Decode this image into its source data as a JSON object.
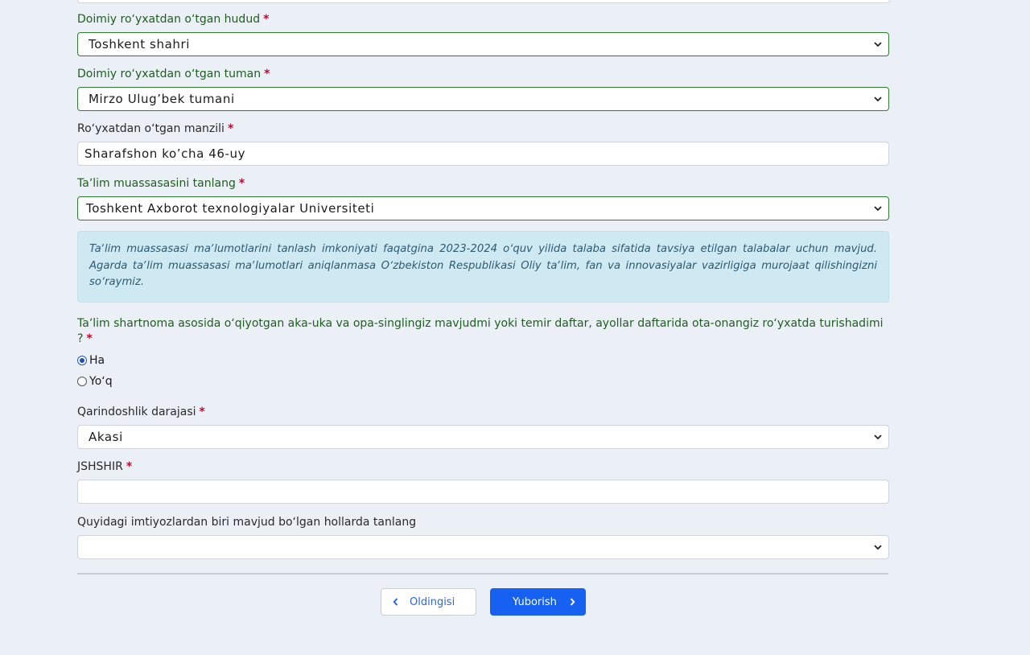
{
  "form": {
    "region": {
      "label": "Doimiy roʻyxatdan oʻtgan hudud",
      "required_mark": "*",
      "value": "Toshkent shahri"
    },
    "district": {
      "label": "Doimiy roʻyxatdan oʻtgan tuman",
      "required_mark": "*",
      "value": "Mirzo Ulug’bek tumani"
    },
    "address": {
      "label": "Roʻyxatdan oʻtgan manzili",
      "required_mark": "*",
      "value": "Sharafshon ko’cha 46-uy"
    },
    "institution": {
      "label": "Taʼlim muassasasini tanlang",
      "required_mark": "*",
      "value": "Toshkent Axborot texnologiyalar Universiteti"
    },
    "info_text": "Taʼlim muassasasi maʼlumotlarini tanlash imkoniyati faqatgina 2023-2024 oʻquv yilida talaba sifatida tavsiya etilgan talabalar uchun mavjud. Agarda taʼlim muassasasi maʼlumotlari aniqlanmasa Oʻzbekiston Respublikasi Oliy taʼlim, fan va innovasiyalar vazirligiga murojaat qilishingizni soʻraymiz.",
    "sibling_question": {
      "label": "Taʼlim shartnoma asosida oʻqiyotgan aka-uka va opa-singlingiz mavjudmi yoki temir daftar, ayollar daftarida ota-onangiz roʻyxatda turishadimi ?",
      "required_mark": "*",
      "options": [
        {
          "label": "Ha",
          "checked": true
        },
        {
          "label": "Yoʻq",
          "checked": false
        }
      ]
    },
    "kinship": {
      "label": "Qarindoshlik darajasi",
      "required_mark": "*",
      "value": "Akasi"
    },
    "jshshir": {
      "label": "JSHSHIR",
      "required_mark": "*",
      "value": ""
    },
    "privileges": {
      "label": "Quyidagi imtiyozlardan biri mavjud boʻlgan hollarda tanlang",
      "value": ""
    }
  },
  "buttons": {
    "prev_label": "Oldingisi",
    "next_label": "Yuborish"
  },
  "colors": {
    "page_background": "#eaf0f6",
    "label_green": "#1f5e1f",
    "required_red": "#d3002b",
    "primary_blue": "#1660f2",
    "info_background": "#cfe9f3"
  },
  "icons": {
    "select_arrow": "chevron-down-icon",
    "prev": "chevron-left-icon",
    "next": "chevron-right-icon"
  }
}
